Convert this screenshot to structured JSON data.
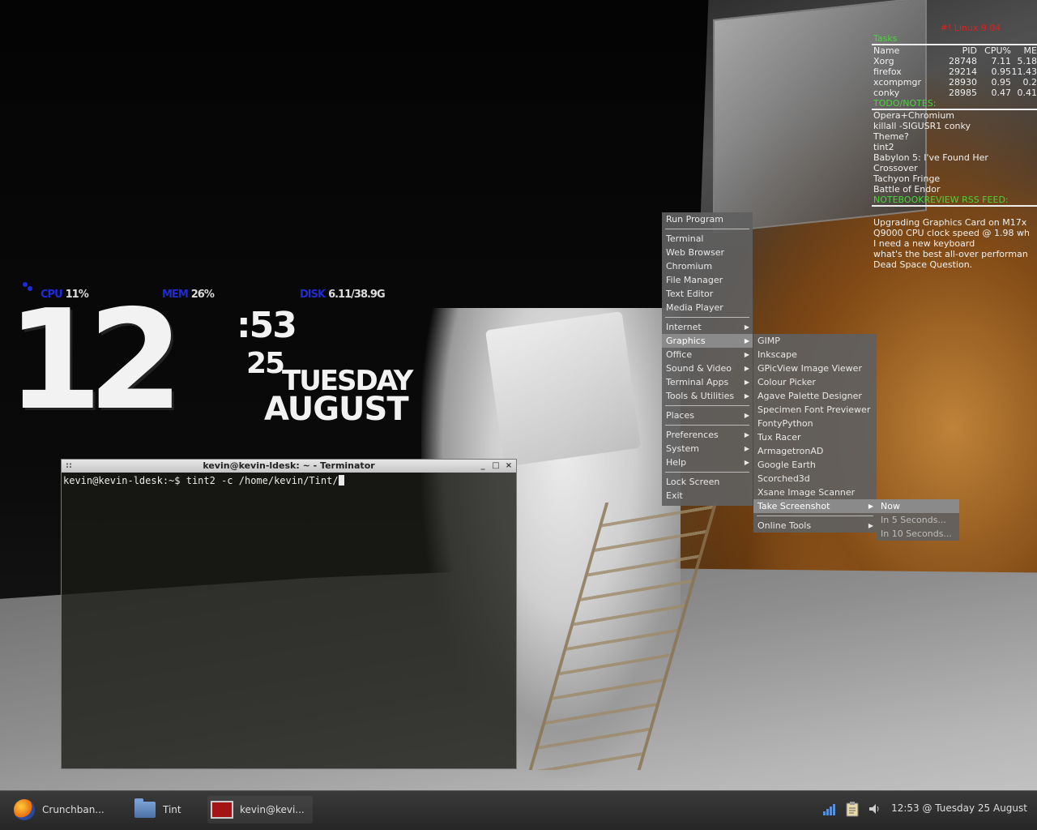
{
  "conky_clock": {
    "cpu_label": "CPU",
    "cpu_value": "11%",
    "mem_label": "MEM",
    "mem_value": "26%",
    "disk_label": "DISK",
    "disk_value": "6.11/38.9G",
    "hour": "12",
    "minute": ":53",
    "day": "25",
    "weekday": "TUESDAY",
    "month": "AUGUST"
  },
  "conky_right": {
    "title": "#! Linux 9.04",
    "tasks_header": "Tasks",
    "columns": [
      "Name",
      "PID",
      "CPU%",
      "ME"
    ],
    "processes": [
      {
        "name": "Xorg",
        "pid": "28748",
        "cpu": "7.11",
        "mem": "5.18"
      },
      {
        "name": "firefox",
        "pid": "29214",
        "cpu": "0.95",
        "mem": "11.43"
      },
      {
        "name": "xcompmgr",
        "pid": "28930",
        "cpu": "0.95",
        "mem": "0.2"
      },
      {
        "name": "conky",
        "pid": "28985",
        "cpu": "0.47",
        "mem": "0.41"
      }
    ],
    "todo_header": "TODO/NOTES:",
    "todo": [
      "Opera+Chromium",
      "killall -SIGUSR1 conky",
      "Theme?",
      "tint2",
      "Babylon 5: I've Found Her",
      "Crossover",
      "Tachyon Fringe",
      "Battle of Endor"
    ],
    "rss_header": "NOTEBOOKREVIEW RSS FEED:",
    "rss": [
      "Upgrading Graphics Card on M17x",
      "Q9000 CPU clock speed @ 1.98 wh",
      "I need a new keyboard",
      "what's the best all-over performan",
      "Dead Space Question."
    ]
  },
  "terminal": {
    "title": "kevin@kevin-ldesk: ~ - Terminator",
    "prompt": "kevin@kevin-ldesk:~$ tint2 -c /home/kevin/Tint/"
  },
  "menu": {
    "run": "Run Program",
    "apps": [
      "Terminal",
      "Web Browser",
      "Chromium",
      "File Manager",
      "Text Editor",
      "Media Player"
    ],
    "categories": [
      "Internet",
      "Graphics",
      "Office",
      "Sound & Video",
      "Terminal Apps",
      "Tools & Utilities"
    ],
    "places": "Places",
    "sys": [
      "Preferences",
      "System",
      "Help"
    ],
    "lock": "Lock Screen",
    "exit": "Exit"
  },
  "graphics_menu": {
    "items": [
      "GIMP",
      "Inkscape",
      "GPicView Image Viewer",
      "Colour Picker",
      "Agave Palette Designer",
      "Specimen Font Previewer",
      "FontyPython",
      "Tux Racer",
      "ArmagetronAD",
      "Google Earth",
      "Scorched3d",
      "Xsane Image Scanner"
    ],
    "screenshot": "Take Screenshot",
    "online": "Online Tools"
  },
  "screenshot_menu": {
    "items": [
      "Now",
      "In 5 Seconds...",
      "In 10 Seconds..."
    ]
  },
  "taskbar": {
    "tasks": [
      "Crunchban...",
      "Tint",
      "kevin@kevi..."
    ],
    "clock": "12:53 @ Tuesday 25 August"
  },
  "icons": {
    "firefox": "firefox-icon",
    "folder": "folder-icon",
    "terminal": "terminal-icon",
    "network": "network-signal-icon",
    "notes": "clipboard-icon",
    "volume": "volume-icon"
  },
  "colors": {
    "conky_accent": "#1d2bd8",
    "conky_title": "#e31f1f",
    "conky_header": "#4bd33c"
  }
}
